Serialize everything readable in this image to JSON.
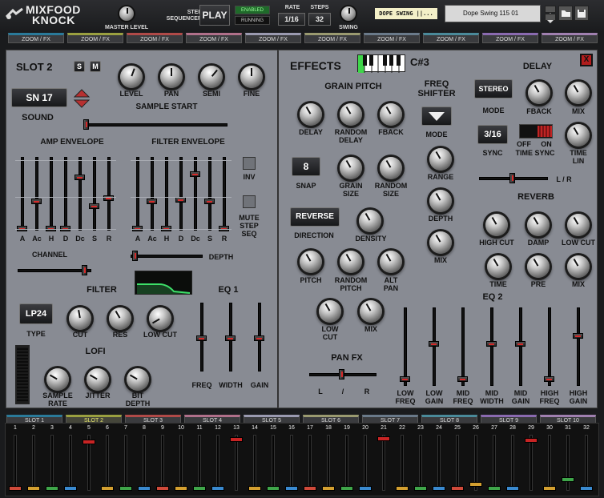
{
  "header": {
    "logo_line1": "MIXFOOD",
    "logo_line2": "KNOCK",
    "master_level_label": "MASTER LEVEL",
    "step_sequencer_label": "STEP\nSEQUENCER",
    "play_label": "PLAY",
    "enabled_label": "ENABLED",
    "running_label": "RUNNING",
    "rate_label": "RATE",
    "rate_value": "1/16",
    "steps_label": "STEPS",
    "steps_value": "32",
    "swing_label": "SWING",
    "preset_logo_text": "DOPE SWING ||...",
    "preset_name": "Dope Swing 115 01"
  },
  "zoom_tabs": [
    "ZOOM / FX",
    "ZOOM / FX",
    "ZOOM / FX",
    "ZOOM / FX",
    "ZOOM / FX",
    "ZOOM / FX",
    "ZOOM / FX",
    "ZOOM / FX",
    "ZOOM / FX",
    "ZOOM / FX"
  ],
  "slot_colors": [
    "#2a7a9a",
    "#9aa040",
    "#b04a48",
    "#b0708a",
    "#9a9ab0",
    "#9a9a70",
    "#6a7a8a",
    "#4a8a9a",
    "#8a6ab0",
    "#a080b0"
  ],
  "slot_panel": {
    "title": "SLOT 2",
    "s_label": "S",
    "m_label": "M",
    "level_label": "LEVEL",
    "pan_label": "PAN",
    "semi_label": "SEMI",
    "fine_label": "FINE",
    "sound_value": "SN 17",
    "sound_label": "SOUND",
    "sample_start_label": "SAMPLE START",
    "amp_env_label": "AMP ENVELOPE",
    "filter_env_label": "FILTER ENVELOPE",
    "env_stage_labels": [
      "A",
      "Ac",
      "H",
      "D",
      "Dc",
      "S",
      "R"
    ],
    "inv_label": "INV",
    "mute_step_seq_label": "MUTE\nSTEP\nSEQ",
    "channel_label": "CHANNEL",
    "depth_label": "DEPTH",
    "filter_label": "FILTER",
    "filter_type_value": "LP24",
    "type_label": "TYPE",
    "cut_label": "CUT",
    "res_label": "RES",
    "low_cut_label": "LOW CUT",
    "eq1_label": "EQ 1",
    "eq1_band_labels": [
      "FREQ",
      "WIDTH",
      "GAIN"
    ],
    "lofi_label": "LOFI",
    "sample_rate_label": "SAMPLE\nRATE",
    "jitter_label": "JITTER",
    "bit_depth_label": "BIT\nDEPTH"
  },
  "effects_panel": {
    "title": "EFFECTS",
    "note_value": "C#3",
    "close_label": "X",
    "grain_pitch_label": "GRAIN PITCH",
    "delay_label": "DELAY",
    "random_delay_label": "RANDOM\nDELAY",
    "fback_label": "FBACK",
    "snap_value": "8",
    "snap_label": "SNAP",
    "grain_size_label": "GRAIN\nSIZE",
    "random_size_label": "RANDOM\nSIZE",
    "reverse_label": "REVERSE",
    "direction_label": "DIRECTION",
    "density_label": "DENSITY",
    "pitch_label": "PITCH",
    "random_pitch_label": "RANDOM\nPITCH",
    "alt_pan_label": "ALT\nPAN",
    "low_cut_label": "LOW\nCUT",
    "mix_label": "MIX",
    "pan_fx_label": "PAN FX",
    "pan_l": "L",
    "pan_mid": "/",
    "pan_r": "R",
    "freq_shifter_label": "FREQ\nSHIFTER",
    "mode_label": "MODE",
    "range_label": "RANGE",
    "depth_label": "DEPTH",
    "fs_mix_label": "MIX",
    "delay_title": "DELAY",
    "stereo_label": "STEREO",
    "delay_mode_label": "MODE",
    "delay_fback_label": "FBACK",
    "delay_mix_label": "MIX",
    "sync_value": "3/16",
    "sync_label": "SYNC",
    "off_label": "OFF",
    "on_label": "ON",
    "time_sync_label": "TIME SYNC",
    "time_lin_label": "TIME\nLIN",
    "lr_label": "L / R",
    "reverb_title": "REVERB",
    "high_cut_label": "HIGH CUT",
    "damp_label": "DAMP",
    "rev_low_cut_label": "LOW CUT",
    "time_label": "TIME",
    "pre_label": "PRE",
    "rev_mix_label": "MIX",
    "eq2_title": "EQ 2",
    "eq2_labels": [
      "LOW\nFREQ",
      "LOW\nGAIN",
      "MID\nFREQ",
      "MID\nWIDTH",
      "MID\nGAIN",
      "HIGH\nFREQ",
      "HIGH\nGAIN"
    ]
  },
  "slot_tabs": [
    "SLOT 1",
    "SLOT 2",
    "SLOT 3",
    "SLOT 4",
    "SLOT 5",
    "SLOT 6",
    "SLOT 7",
    "SLOT 8",
    "SLOT 9",
    "SLOT 10"
  ],
  "steps": [
    "1",
    "2",
    "3",
    "4",
    "5",
    "6",
    "7",
    "8",
    "9",
    "10",
    "11",
    "12",
    "13",
    "14",
    "15",
    "16",
    "17",
    "18",
    "19",
    "20",
    "21",
    "22",
    "23",
    "24",
    "25",
    "26",
    "27",
    "28",
    "29",
    "30",
    "31",
    "32"
  ],
  "step_levels": [
    0,
    0,
    0,
    0,
    0.85,
    0,
    0,
    0,
    0,
    0,
    0,
    0,
    0.9,
    0,
    0,
    0,
    0,
    0,
    0,
    0,
    0.92,
    0,
    0,
    0,
    0,
    0.1,
    0,
    0,
    0.88,
    0,
    0.18,
    0
  ]
}
